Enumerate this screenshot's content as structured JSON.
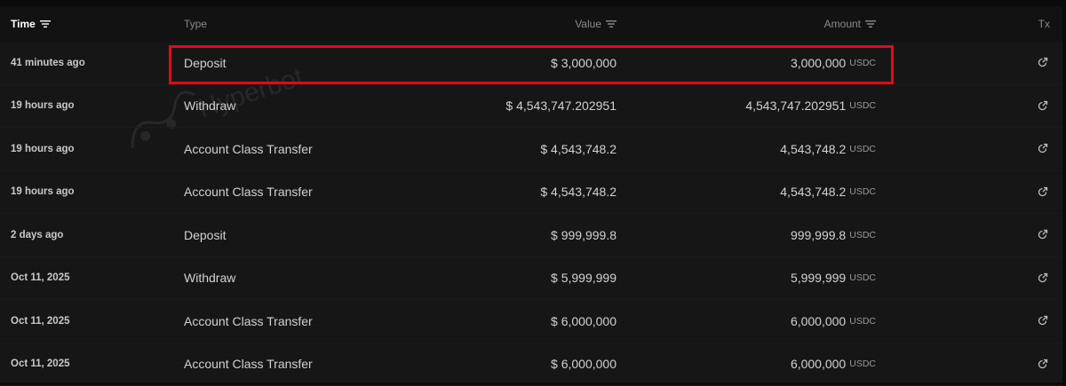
{
  "table": {
    "columns": {
      "time": "Time",
      "type": "Type",
      "value": "Value",
      "amount": "Amount",
      "tx": "Tx"
    },
    "rows": [
      {
        "time": "41 minutes ago",
        "type": "Deposit",
        "value": "$ 3,000,000",
        "amount": "3,000,000",
        "unit": "USDC"
      },
      {
        "time": "19 hours ago",
        "type": "Withdraw",
        "value": "$ 4,543,747.202951",
        "amount": "4,543,747.202951",
        "unit": "USDC"
      },
      {
        "time": "19 hours ago",
        "type": "Account Class Transfer",
        "value": "$ 4,543,748.2",
        "amount": "4,543,748.2",
        "unit": "USDC"
      },
      {
        "time": "19 hours ago",
        "type": "Account Class Transfer",
        "value": "$ 4,543,748.2",
        "amount": "4,543,748.2",
        "unit": "USDC"
      },
      {
        "time": "2 days ago",
        "type": "Deposit",
        "value": "$ 999,999.8",
        "amount": "999,999.8",
        "unit": "USDC"
      },
      {
        "time": "Oct 11, 2025",
        "type": "Withdraw",
        "value": "$ 5,999,999",
        "amount": "5,999,999",
        "unit": "USDC"
      },
      {
        "time": "Oct 11, 2025",
        "type": "Account Class Transfer",
        "value": "$ 6,000,000",
        "amount": "6,000,000",
        "unit": "USDC"
      },
      {
        "time": "Oct 11, 2025",
        "type": "Account Class Transfer",
        "value": "$ 6,000,000",
        "amount": "6,000,000",
        "unit": "USDC"
      }
    ]
  },
  "watermark": {
    "text": "Hyperbot"
  },
  "colors": {
    "highlight": "#e50914",
    "background": "#161616",
    "header": "#121212"
  },
  "icons": {
    "filter": "filter-lines-icon",
    "tx": "external-link-icon"
  }
}
